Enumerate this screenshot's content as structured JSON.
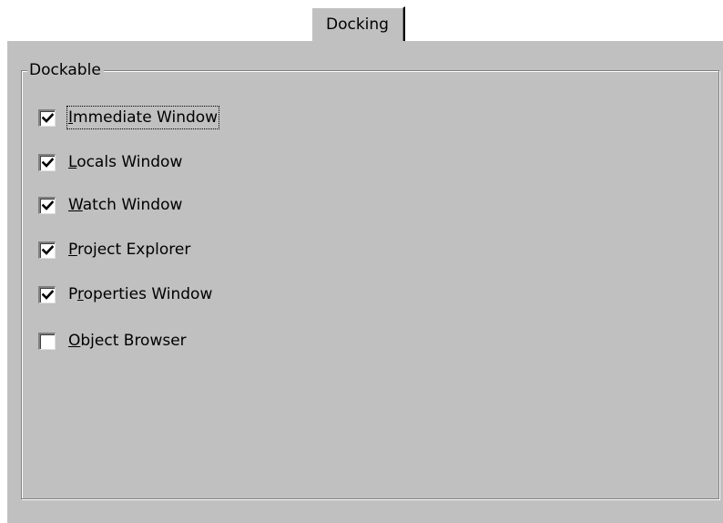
{
  "tab": {
    "label": "Docking"
  },
  "group": {
    "label": "Dockable"
  },
  "items": [
    {
      "pre": "",
      "mnemonic": "I",
      "post": "mmediate Window",
      "checked": true,
      "focused": true
    },
    {
      "pre": "",
      "mnemonic": "L",
      "post": "ocals Window",
      "checked": true,
      "focused": false
    },
    {
      "pre": "",
      "mnemonic": "W",
      "post": "atch Window",
      "checked": true,
      "focused": false
    },
    {
      "pre": "",
      "mnemonic": "P",
      "post": "roject Explorer",
      "checked": true,
      "focused": false
    },
    {
      "pre": "P",
      "mnemonic": "r",
      "post": "operties Window",
      "checked": true,
      "focused": false
    },
    {
      "pre": "",
      "mnemonic": "O",
      "post": "bject Browser",
      "checked": false,
      "focused": false
    }
  ],
  "colors": {
    "face": "#c0c0c0",
    "highlight": "#ffffff",
    "shadow": "#808080",
    "dark": "#000000"
  }
}
